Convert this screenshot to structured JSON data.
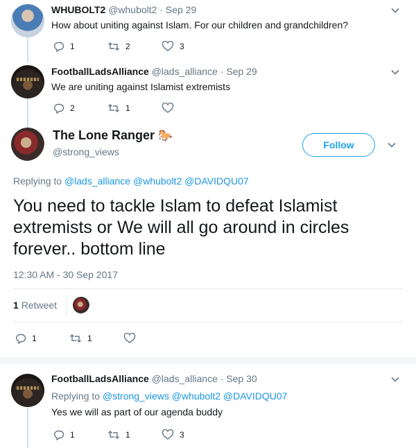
{
  "tweets": [
    {
      "name": "WHUBOLT2",
      "handle": "@whubolt2",
      "date": "Sep 29",
      "text": "How about uniting against Islam. For our children and grandchildren?",
      "replies": "1",
      "retweets": "2",
      "likes": "3"
    },
    {
      "name": "FootballLadsAlliance",
      "handle": "@lads_alliance",
      "date": "Sep 29",
      "text": "We are uniting against Islamist extremists",
      "replies": "2",
      "retweets": "1",
      "likes": ""
    }
  ],
  "focus": {
    "name": "The Lone Ranger",
    "emoji": "🐎",
    "handle": "@strong_views",
    "follow_label": "Follow",
    "replying_prefix": "Replying to",
    "replying_to": [
      "@lads_alliance",
      "@whubolt2",
      "@DAVIDQU07"
    ],
    "text": "You need to tackle Islam to defeat Islamist extremists or We will all go around in circles forever.. bottom line",
    "timestamp": "12:30 AM - 30 Sep 2017",
    "retweet_count": "1",
    "retweet_label": "Retweet",
    "replies": "1",
    "retweets": "1",
    "likes": ""
  },
  "reply": {
    "name": "FootballLadsAlliance",
    "handle": "@lads_alliance",
    "date": "Sep 30",
    "replying_prefix": "Replying to",
    "replying_to": [
      "@strong_views",
      "@whubolt2",
      "@DAVIDQU07"
    ],
    "text": "Yes we will as part of our agenda buddy",
    "replies": "1",
    "retweets": "1",
    "likes": "3"
  },
  "colors": {
    "accent": "#1da1f2",
    "muted": "#657786",
    "text": "#14171a",
    "thread_line": "#cfe0ee"
  }
}
